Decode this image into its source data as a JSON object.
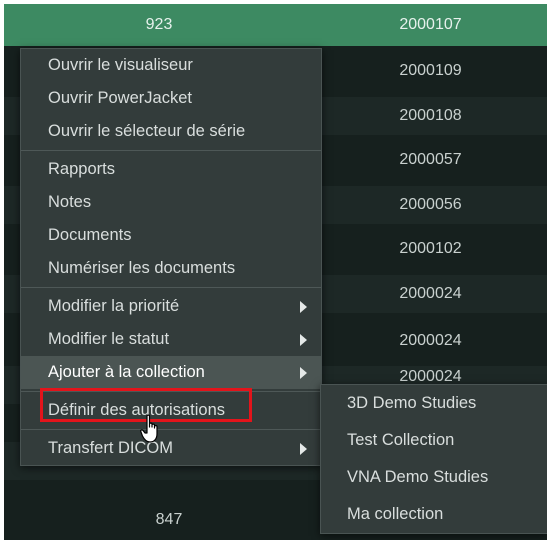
{
  "table": {
    "rows": [
      {
        "c1": "923",
        "c2": "2000107"
      },
      {
        "c1": "",
        "c2": "2000109"
      },
      {
        "c1": "",
        "c2": "2000108"
      },
      {
        "c1": "",
        "c2": "2000057"
      },
      {
        "c1": "",
        "c2": "2000056"
      },
      {
        "c1": "",
        "c2": "2000102"
      },
      {
        "c1": "",
        "c2": "2000024"
      },
      {
        "c1": "",
        "c2": "2000024"
      },
      {
        "c1": "",
        "c2": "2000024"
      },
      {
        "c1": "",
        "c2": ""
      },
      {
        "c1": "",
        "c2": ""
      },
      {
        "c1": "",
        "c2": ""
      },
      {
        "c1": "847",
        "c2": ""
      }
    ]
  },
  "menu": {
    "items": [
      {
        "label": "Ouvrir le visualiseur"
      },
      {
        "label": "Ouvrir PowerJacket"
      },
      {
        "label": "Ouvrir le sélecteur de série"
      },
      {
        "label": "Rapports"
      },
      {
        "label": "Notes"
      },
      {
        "label": "Documents"
      },
      {
        "label": "Numériser les documents"
      },
      {
        "label": "Modifier la priorité"
      },
      {
        "label": "Modifier le statut"
      },
      {
        "label": "Ajouter à la collection"
      },
      {
        "label": "Définir des autorisations"
      },
      {
        "label": "Transfert DICOM"
      }
    ]
  },
  "submenu": {
    "items": [
      {
        "label": "3D Demo Studies"
      },
      {
        "label": "Test Collection"
      },
      {
        "label": "VNA Demo Studies"
      },
      {
        "label": "Ma collection"
      }
    ]
  },
  "colors": {
    "selected_row": "#3d8a62",
    "menu_bg": "#333c3b",
    "highlight": "#e3141b"
  }
}
